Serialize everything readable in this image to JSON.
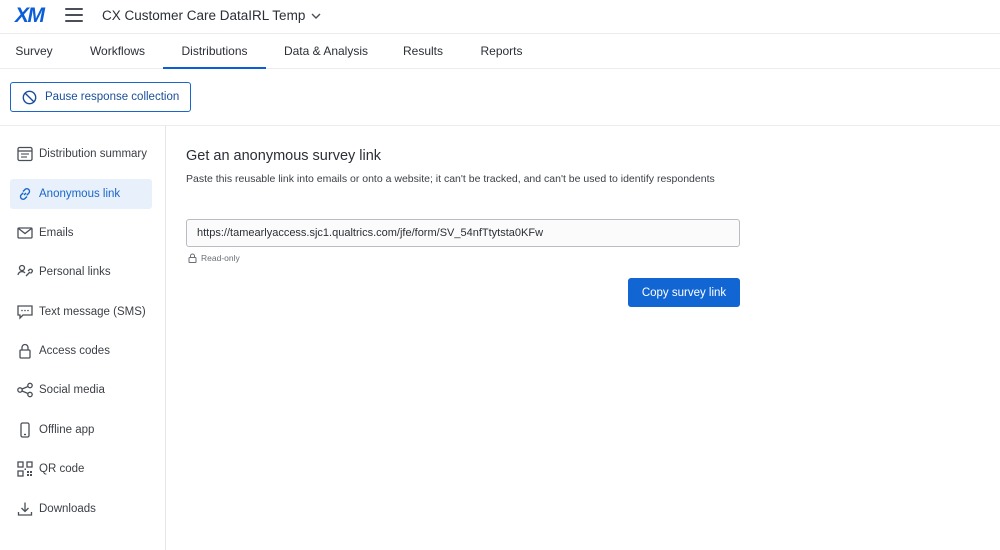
{
  "app": {
    "logo_text": "XM",
    "project_title": "CX Customer Care DataIRL Temp"
  },
  "tabs": [
    {
      "label": "Survey"
    },
    {
      "label": "Workflows"
    },
    {
      "label": "Distributions",
      "active": true
    },
    {
      "label": "Data & Analysis"
    },
    {
      "label": "Results"
    },
    {
      "label": "Reports"
    }
  ],
  "pause_button": {
    "label": "Pause response collection"
  },
  "sidebar": {
    "items": [
      {
        "label": "Distribution summary",
        "icon": "summary-icon"
      },
      {
        "label": "Anonymous link",
        "icon": "link-icon",
        "active": true
      },
      {
        "label": "Emails",
        "icon": "mail-icon"
      },
      {
        "label": "Personal links",
        "icon": "personal-link-icon"
      },
      {
        "label": "Text message (SMS)",
        "icon": "sms-icon"
      },
      {
        "label": "Access codes",
        "icon": "lock-icon"
      },
      {
        "label": "Social media",
        "icon": "share-icon"
      },
      {
        "label": "Offline app",
        "icon": "mobile-icon"
      },
      {
        "label": "QR code",
        "icon": "qr-code-icon"
      },
      {
        "label": "Downloads",
        "icon": "download-icon"
      }
    ]
  },
  "main": {
    "heading": "Get an anonymous survey link",
    "description": "Paste this reusable link into emails or onto a website; it can't be tracked, and can't be used to identify respondents",
    "link_value": "https://tamearlyaccess.sjc1.qualtrics.com/jfe/form/SV_54nfTtytsta0KFw",
    "readonly_label": "Read-only",
    "copy_button": "Copy survey link"
  },
  "colors": {
    "accent": "#0b5ed7",
    "button": "#1266d4",
    "active_bg": "#e8f0fb"
  }
}
